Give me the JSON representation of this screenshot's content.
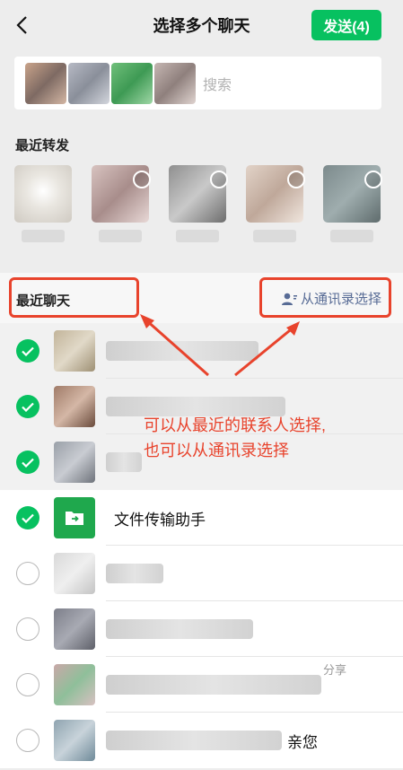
{
  "header": {
    "title": "选择多个聊天",
    "send_label": "发送(4)",
    "back_icon": "chevron-left-icon"
  },
  "search": {
    "placeholder": "搜索",
    "selected_count": 4
  },
  "recent_forward": {
    "label": "最近转发",
    "count": 5
  },
  "recent_chats": {
    "label": "最近聊天",
    "contacts_link": "从通讯录选择",
    "contacts_icon": "contacts-person-icon"
  },
  "chat_list": [
    {
      "name": "",
      "checked": true,
      "type": "blurred"
    },
    {
      "name": "",
      "checked": true,
      "type": "blurred"
    },
    {
      "name": "",
      "checked": true,
      "type": "blurred"
    },
    {
      "name": "文件传输助手",
      "checked": true,
      "type": "file-transfer"
    },
    {
      "name": "",
      "checked": false,
      "type": "blurred"
    },
    {
      "name": "",
      "checked": false,
      "type": "blurred"
    },
    {
      "name": "",
      "checked": false,
      "type": "blurred",
      "suffix": "分享"
    },
    {
      "name": "",
      "checked": false,
      "type": "blurred",
      "suffix": "亲您"
    }
  ],
  "annotation": {
    "line1": "可以从最近的联系人选择,",
    "line2": "也可以从通讯录选择"
  },
  "colors": {
    "accent_green": "#07c160",
    "link_blue": "#576b95",
    "annotation_red": "#e8432c",
    "background": "#ededed"
  }
}
